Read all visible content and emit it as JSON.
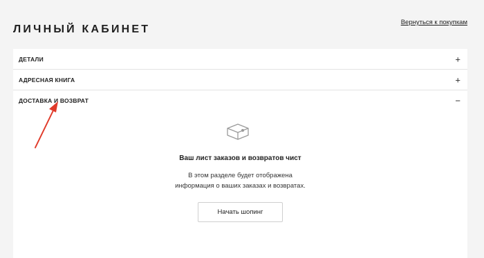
{
  "header": {
    "title": "ЛИЧНЫЙ КАБИНЕТ",
    "back_link": "Вернуться к покупкам"
  },
  "accordion": {
    "items": [
      {
        "label": "ДЕТАЛИ",
        "toggle": "+"
      },
      {
        "label": "АДРЕСНАЯ КНИГА",
        "toggle": "+"
      },
      {
        "label": "ДОСТАВКА И ВОЗВРАТ",
        "toggle": "−"
      }
    ]
  },
  "empty_state": {
    "icon": "box-icon",
    "title": "Ваш лист заказов и возвратов чист",
    "description_line1": "В этом разделе будет отображена",
    "description_line2": "информация о ваших заказах и возвратах.",
    "button_label": "Начать шопинг"
  },
  "colors": {
    "background": "#f4f4f4",
    "panel": "#ffffff",
    "text": "#1f1f1f",
    "annotation_arrow": "#e03a2a"
  }
}
